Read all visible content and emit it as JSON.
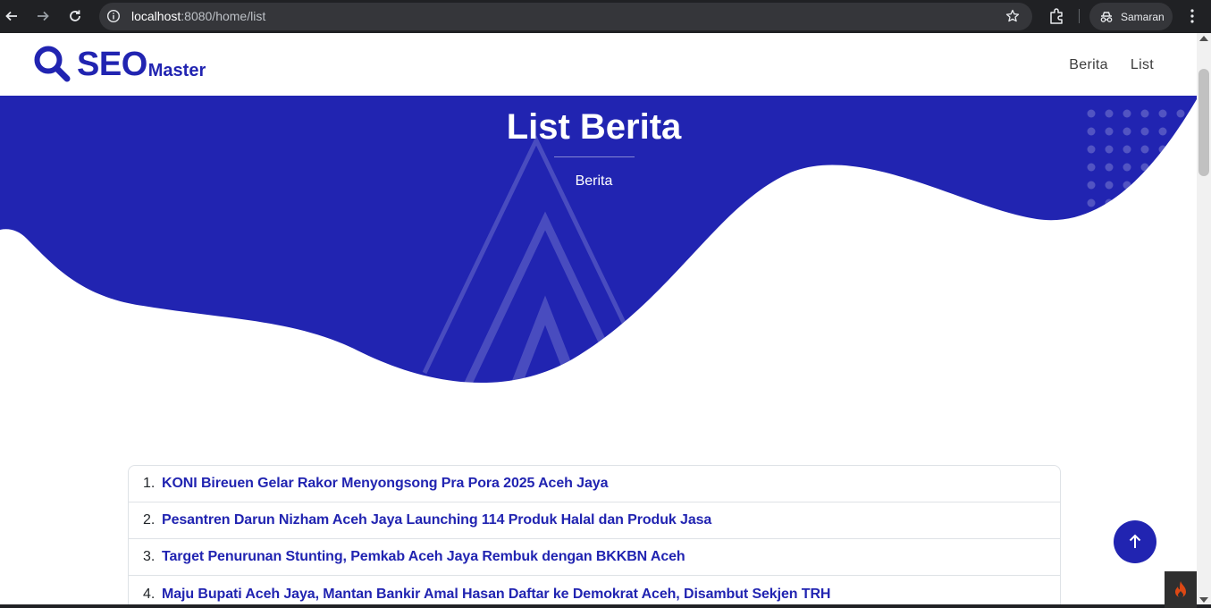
{
  "browser": {
    "url_host": "localhost",
    "url_path": ":8080/home/list",
    "profile_label": "Samaran",
    "icons": [
      "back-icon",
      "forward-icon",
      "reload-icon",
      "site-info-icon",
      "bookmark-star-icon",
      "extensions-icon",
      "incognito-icon",
      "more-menu-icon"
    ]
  },
  "navbar": {
    "logo_main": "SEO",
    "logo_sub": "Master",
    "links": [
      {
        "label": "Berita"
      },
      {
        "label": "List"
      }
    ]
  },
  "hero": {
    "title": "List Berita",
    "subtitle": "Berita"
  },
  "news": {
    "items": [
      {
        "number": "1.",
        "title": "KONI Bireuen Gelar Rakor Menyongsong Pra Pora 2025 Aceh Jaya"
      },
      {
        "number": "2.",
        "title": "Pesantren Darun Nizham Aceh Jaya Launching 114 Produk Halal dan Produk Jasa"
      },
      {
        "number": "3.",
        "title": "Target Penurunan Stunting, Pemkab Aceh Jaya Rembuk dengan BKKBN Aceh"
      },
      {
        "number": "4.",
        "title": "Maju Bupati Aceh Jaya, Mantan Bankir Amal Hasan Daftar ke Demokrat Aceh, Disambut Sekjen TRH"
      }
    ]
  },
  "colors": {
    "brand": "#2124b1",
    "chrome_bg": "#202124",
    "text": "#212529"
  }
}
